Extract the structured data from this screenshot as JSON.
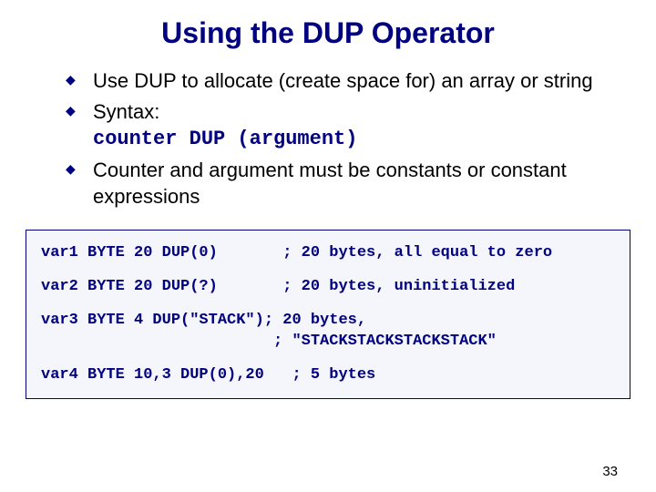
{
  "title": "Using the DUP Operator",
  "bullets": [
    {
      "text": "Use DUP to allocate (create space for) an array or string"
    },
    {
      "text_pre": "Syntax:",
      "code": "counter DUP (argument)"
    },
    {
      "text": "Counter and argument must be constants or constant expressions"
    }
  ],
  "code_lines": [
    "var1 BYTE 20 DUP(0)       ; 20 bytes, all equal to zero",
    "var2 BYTE 20 DUP(?)       ; 20 bytes, uninitialized",
    "var3 BYTE 4 DUP(\"STACK\"); 20 bytes,\n                         ; \"STACKSTACKSTACKSTACK\"",
    "var4 BYTE 10,3 DUP(0),20   ; 5 bytes"
  ],
  "page_number": "33"
}
